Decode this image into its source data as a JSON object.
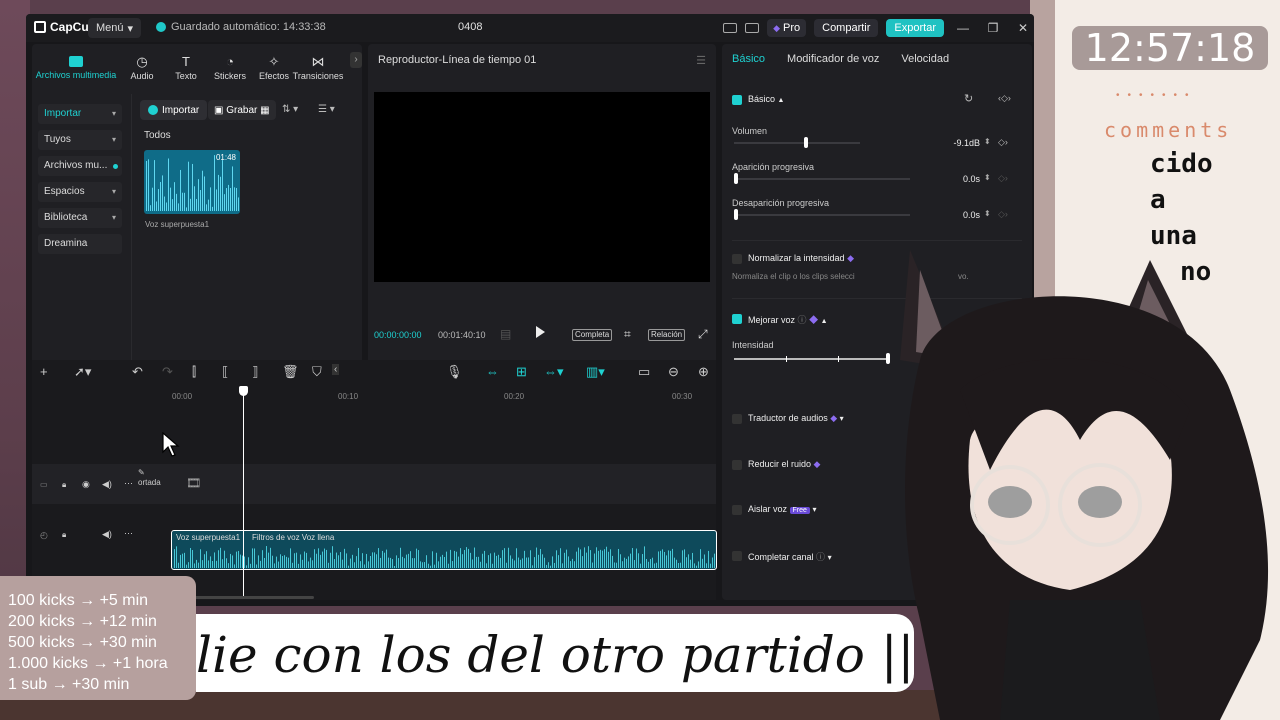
{
  "app": {
    "logo": "CapCut",
    "menu": "Menú",
    "autosave": "Guardado automático: 14:33:38",
    "project": "0408",
    "pro": "Pro",
    "share": "Compartir",
    "export": "Exportar"
  },
  "media": {
    "tabs": [
      "Archivos multimedia",
      "Audio",
      "Texto",
      "Stickers",
      "Efectos",
      "Transiciones"
    ],
    "sidebar": [
      "Importar",
      "Tuyos",
      "Archivos mu...",
      "Espacios",
      "Biblioteca",
      "Dreamina"
    ],
    "import_btn": "Importar",
    "record_btn": "Grabar",
    "section": "Todos",
    "thumb_duration": "01:48",
    "thumb_label": "Voz superpuesta1"
  },
  "player": {
    "title": "Reproductor-Línea de tiempo 01",
    "time_current": "00:00:00:00",
    "time_total": "00:01:40:10",
    "full": "Completa",
    "ratio": "Relación"
  },
  "props": {
    "tabs": [
      "Básico",
      "Modificador de voz",
      "Velocidad"
    ],
    "section_basic": "Básico",
    "volume_label": "Volumen",
    "volume_value": "-9.1dB",
    "volume_level": 0.64,
    "fadein_label": "Aparición progresiva",
    "fadein_value": "0.0s",
    "fadeout_label": "Desaparición progresiva",
    "fadeout_value": "0.0s",
    "normalize": "Normalizar la intensidad",
    "normalize_hint": "Normaliza el clip o los clips selecci",
    "normalize_hint_end": "vo.",
    "enhance": "Mejorar voz",
    "intensity_label": "Intensidad",
    "intensity_level": 1.0,
    "translate": "Traductor de audios",
    "noise": "Reducir el ruido",
    "isolate": "Aislar voz",
    "isolate_badge": "Free",
    "complete": "Completar canal"
  },
  "timeline": {
    "ruler": [
      "00:00",
      "00:10",
      "00:20",
      "00:30"
    ],
    "cover": "ortada",
    "clip_label": "Voz superpuesta1",
    "clip_filter": "Filtros de voz Voz llena"
  },
  "overlay": {
    "clock": "12:57:18",
    "comments_title": "comments",
    "chat_lines": [
      "cido",
      "a",
      "una",
      "no"
    ],
    "kicks": [
      "100 kicks → +5 min",
      "200 kicks → +12 min",
      "500 kicks → +30 min",
      "1.000 kicks → +1 hora",
      "1 sub → +30 min"
    ],
    "banner": "lie con los del otro partido || ("
  },
  "colors": {
    "accent": "#1fd1d1",
    "pro": "#8c6cf0",
    "clip": "#0e4a5b"
  }
}
